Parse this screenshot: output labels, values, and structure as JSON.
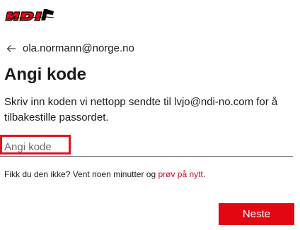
{
  "brand": {
    "logo_text": "NDI",
    "accent_color": "#e30613"
  },
  "identity": {
    "back_icon": "arrow-left-icon",
    "email": "ola.normann@norge.no"
  },
  "page": {
    "title": "Angi kode",
    "description": "Skriv inn koden vi nettopp sendte til lvjo@ndi-no.com for å tilbakestille passordet."
  },
  "code_input": {
    "placeholder": "Angi kode",
    "value": ""
  },
  "retry": {
    "prefix": "Fikk du den ikke? Vent noen minutter og ",
    "link_label": "prøv på nytt",
    "suffix": "."
  },
  "actions": {
    "next_label": "Neste"
  }
}
